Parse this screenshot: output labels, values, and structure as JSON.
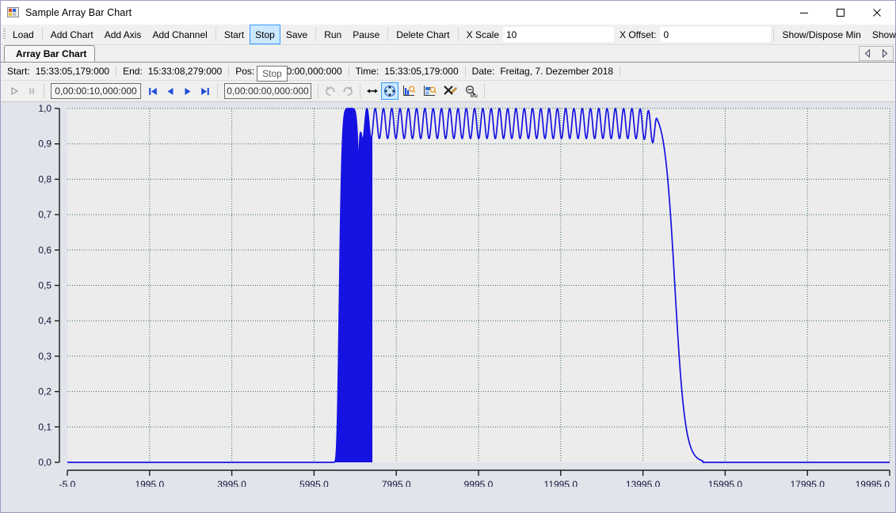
{
  "window": {
    "title": "Sample Array Bar Chart",
    "icon": "app-grid-icon",
    "buttons": {
      "minimize": "minimize-icon",
      "maximize": "maximize-icon",
      "close": "close-icon"
    }
  },
  "menustrip": {
    "items": [
      {
        "label": "Load",
        "selected": false
      },
      {
        "sep": true
      },
      {
        "label": "Add Chart",
        "selected": false
      },
      {
        "label": "Add Axis",
        "selected": false
      },
      {
        "label": "Add Channel",
        "selected": false
      },
      {
        "sep": true
      },
      {
        "label": "Start",
        "selected": false
      },
      {
        "label": "Stop",
        "selected": true
      },
      {
        "label": "Save",
        "selected": false
      },
      {
        "sep": true
      },
      {
        "label": "Run",
        "selected": false
      },
      {
        "label": "Pause",
        "selected": false
      },
      {
        "sep": true
      },
      {
        "label": "Delete Chart",
        "selected": false
      },
      {
        "sep": true
      }
    ],
    "x_scale": {
      "label": "X Scale",
      "value": "10"
    },
    "x_offset": {
      "label": "X Offset:",
      "value": "0"
    },
    "show_dispose_min": "Show/Dispose Min",
    "show_dispose_max": "Show/Dispose Max"
  },
  "tabs": {
    "items": [
      {
        "label": "Array Bar Chart",
        "active": true
      }
    ],
    "nav_prev": "tab-prev-icon",
    "nav_next": "tab-next-icon"
  },
  "infobar": {
    "start": {
      "key": "Start:",
      "value": "15:33:05,179:000"
    },
    "end": {
      "key": "End:",
      "value": "15:33:08,279:000"
    },
    "pos": {
      "key": "Pos:",
      "value": "0,00:00:00,000:000"
    },
    "time": {
      "key": "Time:",
      "value": "15:33:05,179:000"
    },
    "date": {
      "key": "Date:",
      "value": "Freitag, 7. Dezember 2018"
    }
  },
  "tooltip": {
    "text": "Stop"
  },
  "playbar": {
    "play": "play-icon",
    "pause": "pause-icon",
    "duration_value": "0,00:00:10,000:000",
    "skip_start": "skip-to-start-icon",
    "step_back": "step-back-icon",
    "step_forward": "step-forward-icon",
    "skip_end": "skip-to-end-icon",
    "position_value": "0,00:00:00,000:000",
    "undo": "rotate-left-icon",
    "redo": "rotate-right-icon",
    "fit_horizontal": "fit-horizontal-icon",
    "pan": "pan-move-icon",
    "zoom_y": "zoom-y-axis-icon",
    "zoom_x": "zoom-x-axis-icon",
    "clear_zoom": "clear-zoom-icon",
    "zoom_max": "zoom-max-icon"
  },
  "chart_data": {
    "type": "line",
    "title": "",
    "xlabel": "",
    "ylabel": "",
    "series_color": "#1512e2",
    "fill_color": "#1512e2",
    "plot_bg": "#ececec",
    "grid": true,
    "grid_color": "#3c6b50",
    "axis_color": "#1a1a1a",
    "xlim": [
      -5,
      19995
    ],
    "ylim": [
      0.0,
      1.0
    ],
    "xticks": [
      -5,
      1995,
      3995,
      5995,
      7995,
      9995,
      11995,
      13995,
      15995,
      17995,
      19995
    ],
    "xticklabels": [
      "-5,0",
      "1995,0",
      "3995,0",
      "5995,0",
      "7995,0",
      "9995,0",
      "11995,0",
      "13995,0",
      "15995,0",
      "17995,0",
      "19995,0"
    ],
    "yticks": [
      0.0,
      0.1,
      0.2,
      0.3,
      0.4,
      0.5,
      0.6,
      0.7,
      0.8,
      0.9,
      1.0
    ],
    "yticklabels": [
      "0,0",
      "0,1",
      "0,2",
      "0,3",
      "0,4",
      "0,5",
      "0,6",
      "0,7",
      "0,8",
      "0,9",
      "1,0"
    ],
    "description": "Filled Gaussian-like pulse near x=6800 rising to 1,0, followed by a dense oscillating band (~36 cycles) oscillating between about 0,92 and 1,0 spanning x≈7100 to x≈14300, then a steep sigmoid fall to 0,0 by x≈15400; flat baseline at 0,0 elsewhere.",
    "features": {
      "baseline": 0.0,
      "peak_value": 1.0,
      "pulse_center_x": 6870,
      "pulse_half_width_x": 520,
      "oscillation_start_x": 7080,
      "oscillation_end_x": 14330,
      "oscillation_cycles": 36,
      "oscillation_min": 0.915,
      "oscillation_max": 1.0,
      "falloff_start_x": 14330,
      "falloff_end_x": 15450
    }
  }
}
